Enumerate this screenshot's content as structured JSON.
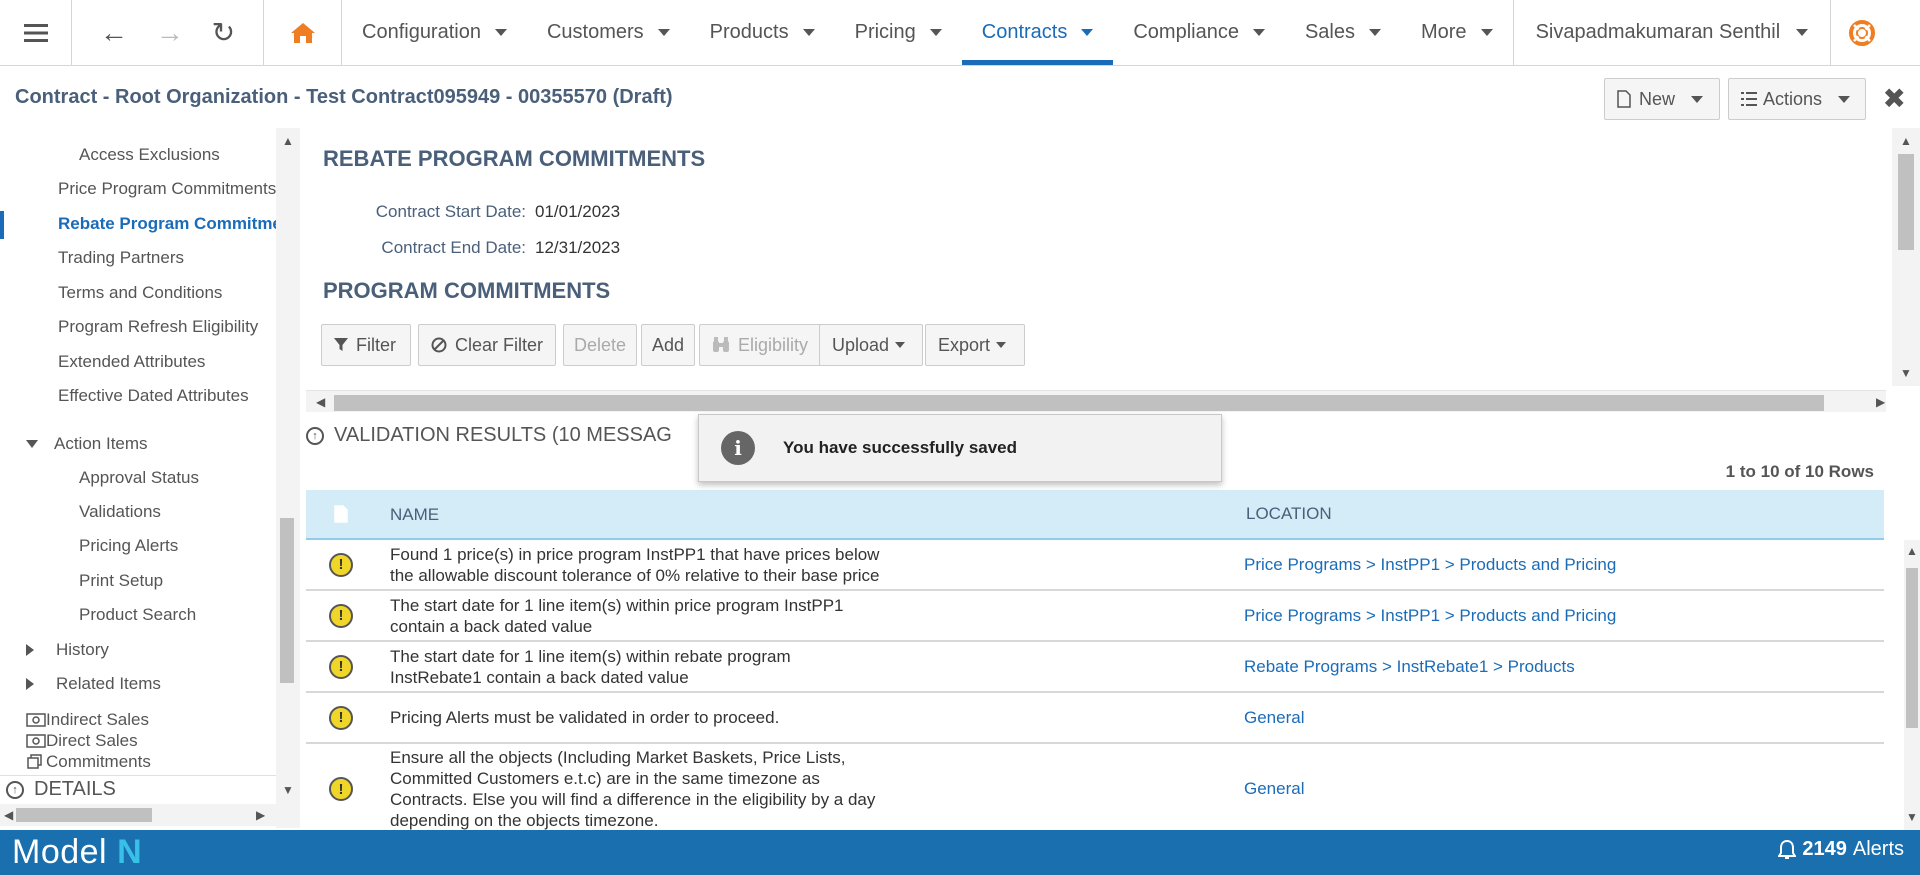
{
  "nav": {
    "menus": [
      {
        "label": "Configuration",
        "active": false
      },
      {
        "label": "Customers",
        "active": false
      },
      {
        "label": "Products",
        "active": false
      },
      {
        "label": "Pricing",
        "active": false
      },
      {
        "label": "Contracts",
        "active": true
      },
      {
        "label": "Compliance",
        "active": false
      },
      {
        "label": "Sales",
        "active": false
      },
      {
        "label": "More",
        "active": false
      }
    ],
    "user": "Sivapadmakumaran Senthil"
  },
  "title": {
    "text": "Contract - Root Organization - Test Contract095949 - 00355570 (Draft)",
    "new_label": "New",
    "actions_label": "Actions"
  },
  "sidebar": {
    "items": [
      {
        "label": "Access Exclusions"
      },
      {
        "label": "Price Program Commitments"
      },
      {
        "label": "Rebate Program Commitments"
      },
      {
        "label": "Trading Partners"
      },
      {
        "label": "Terms and Conditions"
      },
      {
        "label": "Program Refresh Eligibility"
      },
      {
        "label": "Extended Attributes"
      },
      {
        "label": "Effective Dated Attributes"
      },
      {
        "label": "Action Items"
      },
      {
        "label": "Approval Status"
      },
      {
        "label": "Validations"
      },
      {
        "label": "Pricing Alerts"
      },
      {
        "label": "Print Setup"
      },
      {
        "label": "Product Search"
      },
      {
        "label": "History"
      },
      {
        "label": "Related Items"
      },
      {
        "label": "Indirect Sales"
      },
      {
        "label": "Direct Sales"
      },
      {
        "label": "Commitments"
      }
    ],
    "details_label": "DETAILS"
  },
  "main": {
    "section_title": "REBATE PROGRAM COMMITMENTS",
    "start_date_label": "Contract Start Date:",
    "start_date": "01/01/2023",
    "end_date_label": "Contract End Date:",
    "end_date": "12/31/2023",
    "program_title": "PROGRAM COMMITMENTS",
    "toolbar": {
      "filter": "Filter",
      "clear_filter": "Clear Filter",
      "delete": "Delete",
      "add": "Add",
      "eligibility": "Eligibility",
      "upload": "Upload",
      "export": "Export"
    }
  },
  "validation": {
    "title": "VALIDATION RESULTS (10 MESSAG",
    "rows_info": "1 to 10 of 10 Rows",
    "col_name": "NAME",
    "col_location": "LOCATION",
    "rows": [
      {
        "name_lines": [
          "Found 1 price(s) in price program InstPP1 that have prices below",
          "the allowable discount tolerance of 0% relative to their base price"
        ],
        "location": "Price Programs > InstPP1 > Products and Pricing"
      },
      {
        "name_lines": [
          "The start date for 1 line item(s) within price program InstPP1",
          "contain a back dated value"
        ],
        "location": "Price Programs > InstPP1 > Products and Pricing"
      },
      {
        "name_lines": [
          "The start date for 1 line item(s) within rebate program",
          "InstRebate1 contain a back dated value"
        ],
        "location": "Rebate Programs > InstRebate1 > Products"
      },
      {
        "name_lines": [
          "Pricing Alerts must be validated in order to proceed."
        ],
        "location": "General"
      },
      {
        "name_lines": [
          "Ensure all the objects (Including Market Baskets, Price Lists,",
          "Committed Customers e.t.c) are in the same timezone as",
          "Contracts. Else you will find a difference in the eligibility by a day",
          "depending on the objects timezone."
        ],
        "location": "General"
      }
    ]
  },
  "toast": {
    "message": "You have successfully saved"
  },
  "footer": {
    "logo_text": "Model",
    "logo_mark": "N",
    "alerts_count": "2149",
    "alerts_label": "Alerts"
  },
  "colors": {
    "primary": "#1b6cb8",
    "footer": "#1a6fae",
    "home_icon": "#f07d1f",
    "warning": "#f1d62a",
    "header_bg": "#d4ecf7"
  }
}
